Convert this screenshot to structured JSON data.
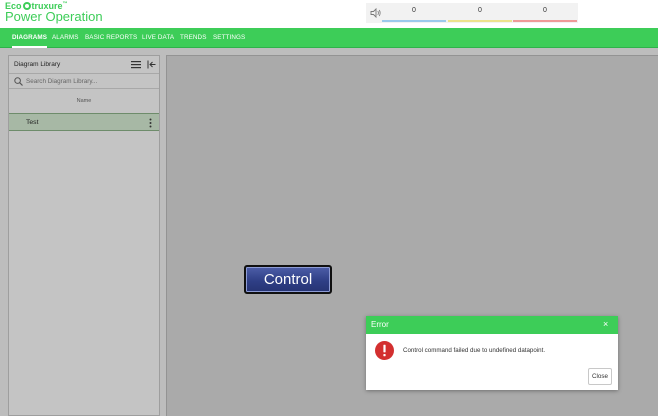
{
  "brand": {
    "eco": "Eco",
    "struxure": "truxure",
    "trademark": "™",
    "product": "Power Operation"
  },
  "alarms": {
    "mute_icon": "speaker-icon",
    "counts": [
      {
        "value": "0",
        "color": "#9cc9ec"
      },
      {
        "value": "0",
        "color": "#ede28d"
      },
      {
        "value": "0",
        "color": "#ee9a98"
      }
    ]
  },
  "nav": {
    "items": [
      {
        "label": "DIAGRAMS",
        "active": true
      },
      {
        "label": "ALARMS"
      },
      {
        "label": "BASIC REPORTS"
      },
      {
        "label": "LIVE DATA"
      },
      {
        "label": "TRENDS"
      },
      {
        "label": "SETTINGS"
      }
    ]
  },
  "library": {
    "title": "Diagram Library",
    "search_placeholder": "Search Diagram Library...",
    "column": "Name",
    "items": [
      {
        "label": "Test"
      }
    ]
  },
  "canvas": {
    "control_label": "Control"
  },
  "dialog": {
    "title": "Error",
    "close_x": "×",
    "message": "Control command failed due to undefined datapoint.",
    "close_label": "Close"
  },
  "colors": {
    "brand_green": "#3dcd58",
    "error_red": "#d32f2f"
  }
}
